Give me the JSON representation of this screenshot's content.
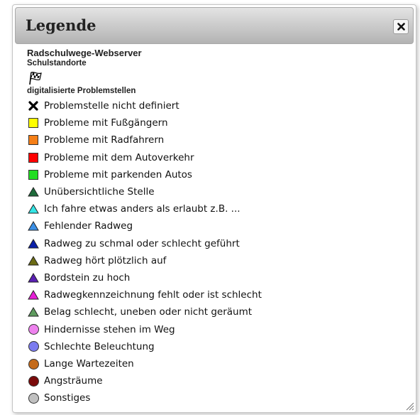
{
  "dialog": {
    "title": "Legende",
    "close_icon": "close-icon"
  },
  "legend": {
    "server_title": "Radschulwege-Webserver",
    "school_heading": "Schulstandorte",
    "school_icon": "checkered-flag-icon",
    "problems_heading": "digitalisierte Problemstellen",
    "items": [
      {
        "label": "Problemstelle nicht definiert",
        "shape": "x",
        "color": "#000000"
      },
      {
        "label": "Probleme mit Fußgängern",
        "shape": "square",
        "color": "#ffff00"
      },
      {
        "label": "Probleme mit Radfahrern",
        "shape": "square",
        "color": "#f57f17"
      },
      {
        "label": "Probleme mit dem Autoverkehr",
        "shape": "square",
        "color": "#ff0000"
      },
      {
        "label": "Probleme mit parkenden Autos",
        "shape": "square",
        "color": "#22dd22"
      },
      {
        "label": "Unübersichtliche Stelle",
        "shape": "triangle",
        "color": "#1e6b3a"
      },
      {
        "label": "Ich fahre etwas anders als erlaubt z.B. ...",
        "shape": "triangle",
        "color": "#33e6e6"
      },
      {
        "label": "Fehlender Radweg",
        "shape": "triangle",
        "color": "#3a8fe6"
      },
      {
        "label": "Radweg zu schmal oder schlecht geführt",
        "shape": "triangle",
        "color": "#0a1fa8"
      },
      {
        "label": "Radweg hört plötzlich auf",
        "shape": "triangle",
        "color": "#6b6b14"
      },
      {
        "label": "Bordstein zu hoch",
        "shape": "triangle",
        "color": "#5a1fb3"
      },
      {
        "label": "Radwegkennzeichnung fehlt oder ist schlecht",
        "shape": "triangle",
        "color": "#e61fd6"
      },
      {
        "label": "Belag schlecht, uneben oder nicht geräumt",
        "shape": "triangle",
        "color": "#5f9c5f"
      },
      {
        "label": "Hindernisse stehen im Weg",
        "shape": "circle",
        "color": "#ee82ee"
      },
      {
        "label": "Schlechte Beleuchtung",
        "shape": "circle",
        "color": "#7b7bef"
      },
      {
        "label": "Lange Wartezeiten",
        "shape": "circle",
        "color": "#c46a1a"
      },
      {
        "label": "Angsträume",
        "shape": "circle",
        "color": "#7a0a0a"
      },
      {
        "label": "Sonstiges",
        "shape": "circle",
        "color": "#c0c0c0"
      }
    ]
  }
}
